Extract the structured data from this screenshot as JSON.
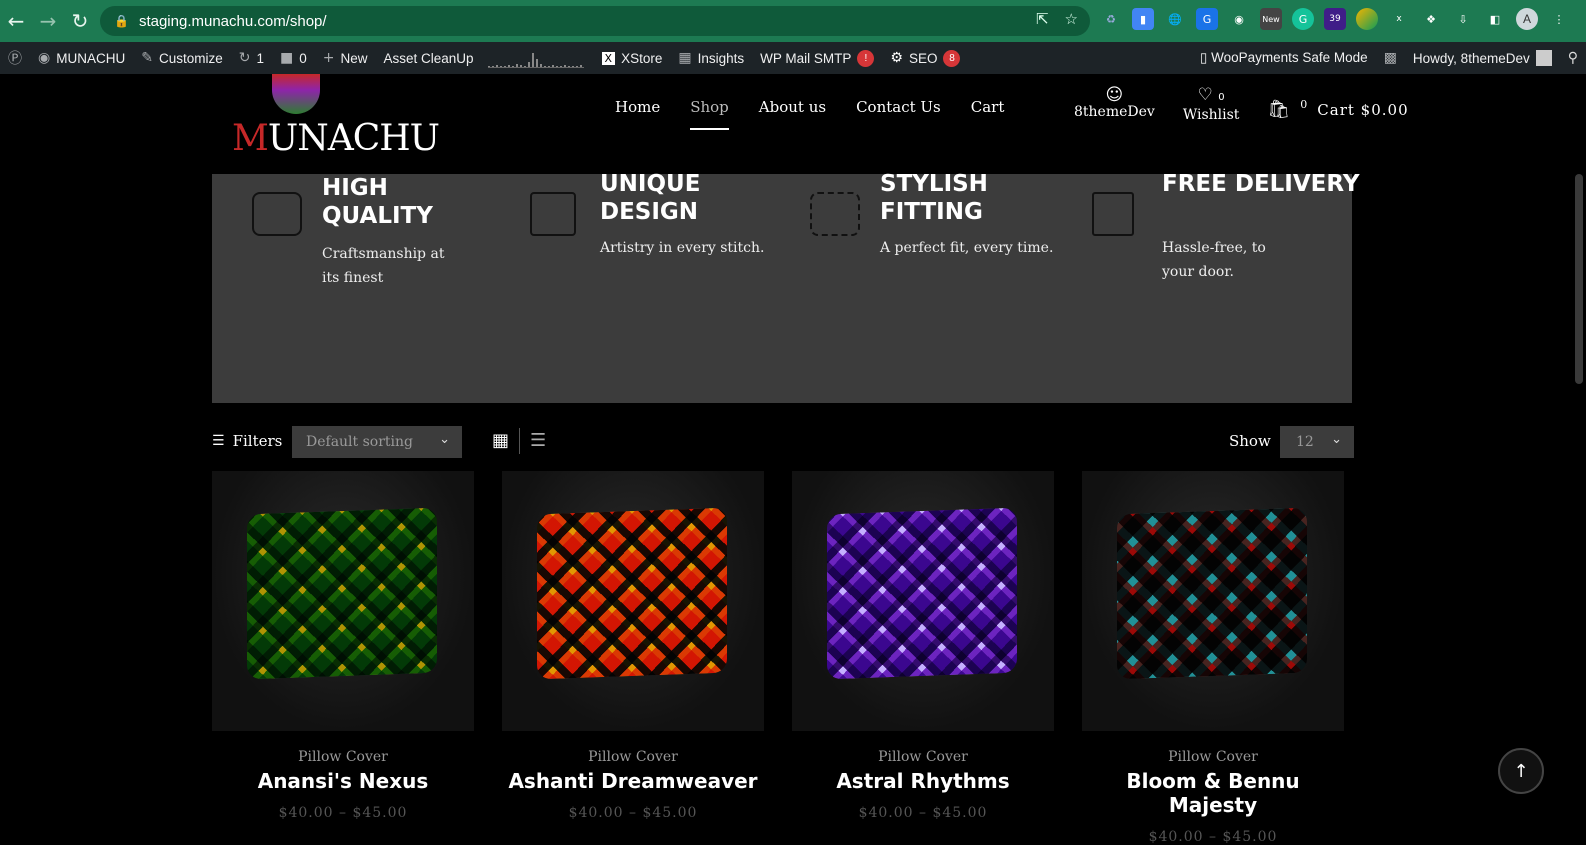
{
  "browser": {
    "url": "staging.munachu.com/shop/",
    "avatar_letter": "A",
    "ext_new_label": "New",
    "ext_count": "39",
    "ext_x": "x"
  },
  "wp_admin_bar": {
    "site_name": "MUNACHU",
    "customize": "Customize",
    "updates_count": "1",
    "comments_count": "0",
    "new": "New",
    "asset_cleanup": "Asset CleanUp",
    "xstore": "XStore",
    "insights": "Insights",
    "wp_mail_smtp": "WP Mail SMTP",
    "wp_mail_badge": "!",
    "seo": "SEO",
    "seo_badge": "8",
    "woopayments": "▯ WooPayments Safe Mode",
    "howdy": "Howdy, 8themeDev"
  },
  "header": {
    "logo_first": "M",
    "logo_rest": "UNACHU",
    "nav": [
      "Home",
      "Shop",
      "About us",
      "Contact Us",
      "Cart"
    ],
    "account_label": "8themeDev",
    "wishlist_count": "0",
    "wishlist_label": "Wishlist",
    "cart_count": "0",
    "cart_label": "Cart $0.00"
  },
  "features": [
    {
      "title": "HIGH QUALITY",
      "text": "Craftsmanship at its finest"
    },
    {
      "title": "UNIQUE DESIGN",
      "text": "Artistry in every stitch."
    },
    {
      "title": "STYLISH FITTING",
      "text": "A perfect fit, every time."
    },
    {
      "title": "FREE DELIVERY",
      "text": "Hassle-free, to your door."
    }
  ],
  "toolbar": {
    "filters": "Filters",
    "sorting": "Default sorting",
    "show_label": "Show",
    "show_value": "12"
  },
  "products": [
    {
      "category": "Pillow Cover",
      "name": "Anansi's Nexus",
      "price": "$40.00 – $45.00",
      "colors": [
        "#1b7a2a",
        "#d4c21a",
        "#0b3d1a"
      ]
    },
    {
      "category": "Pillow Cover",
      "name": "Ashanti Dreamweaver",
      "price": "$40.00 – $45.00",
      "colors": [
        "#e84a1a",
        "#f0c419",
        "#1a1a1a"
      ]
    },
    {
      "category": "Pillow Cover",
      "name": "Astral Rhythms",
      "price": "$40.00 – $45.00",
      "colors": [
        "#7b2bbf",
        "#e0d4ff",
        "#3b0f6e"
      ]
    },
    {
      "category": "Pillow Cover",
      "name": "Bloom & Bennu Majesty",
      "price": "$40.00 – $45.00",
      "colors": [
        "#1c1c1c",
        "#c8302a",
        "#5cc0c4"
      ]
    }
  ]
}
